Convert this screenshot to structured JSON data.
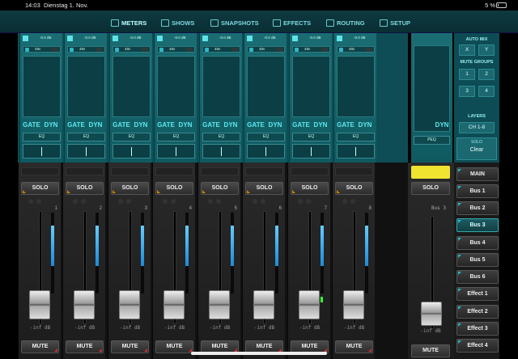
{
  "status": {
    "time": "14:03",
    "date": "Dienstag 1. Nov.",
    "right": "5 %"
  },
  "nav": {
    "items": [
      {
        "label": "METERS",
        "icon": "meters-icon"
      },
      {
        "label": "SHOWS",
        "icon": "shows-icon"
      },
      {
        "label": "SNAPSHOTS",
        "icon": "snapshots-icon"
      },
      {
        "label": "EFFECTS",
        "icon": "effects-icon"
      },
      {
        "label": "ROUTING",
        "icon": "routing-icon"
      },
      {
        "label": "SETUP",
        "icon": "setup-icon"
      }
    ]
  },
  "channel": {
    "db_label": "-0.0 dB",
    "phantom": "48v",
    "gate": "GATE",
    "dyn": "DYN",
    "eq": "EQ",
    "solo": "SOLO",
    "mute": "MUTE",
    "inf": "-inf dB"
  },
  "channels": [
    {
      "num": "1"
    },
    {
      "num": "2"
    },
    {
      "num": "3"
    },
    {
      "num": "4"
    },
    {
      "num": "5"
    },
    {
      "num": "6"
    },
    {
      "num": "7"
    },
    {
      "num": "8"
    }
  ],
  "bus": {
    "dyn": "DYN",
    "peq": "PEQ",
    "solo": "SOLO",
    "mute": "MUTE",
    "name": "Bus 3",
    "inf": "-inf dB"
  },
  "right_panel": {
    "auto_mix": "AUTO MIX",
    "x": "X",
    "y": "Y",
    "mute_groups": "MUTE GROUPS",
    "mg": [
      "1",
      "2",
      "3",
      "4"
    ],
    "layers": "LAYERS",
    "layer_value": "CH 1-8",
    "solo": "SOLO",
    "clear": "Clear"
  },
  "mixes": {
    "items": [
      "MAIN",
      "Bus 1",
      "Bus 2",
      "Bus 3",
      "Bus 4",
      "Bus 5",
      "Bus 6",
      "Effect 1",
      "Effect 2",
      "Effect 3",
      "Effect 4"
    ],
    "selected": "Bus 3"
  },
  "colors": {
    "accent": "#5ee8ee",
    "selected_bus": "#f0e430"
  }
}
